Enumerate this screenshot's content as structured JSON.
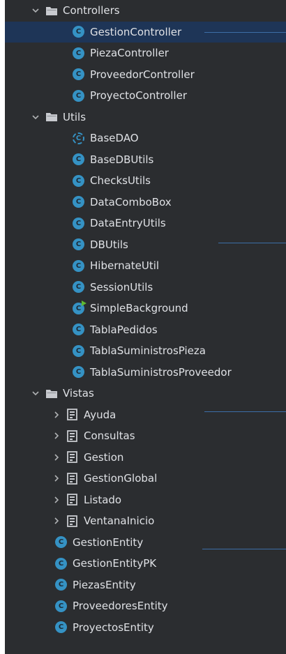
{
  "colors": {
    "background": "#2b2d30",
    "selected_row": "#1e3557",
    "class_icon": "#3592c4",
    "text": "#dfe1e5",
    "guide_line": "#3c6ea8"
  },
  "tree": {
    "controllers": {
      "label": "Controllers",
      "icon": "folder-icon",
      "expanded": true,
      "items": [
        {
          "label": "GestionController",
          "icon": "class-icon",
          "selected": true
        },
        {
          "label": "PiezaController",
          "icon": "class-icon"
        },
        {
          "label": "ProveedorController",
          "icon": "class-icon"
        },
        {
          "label": "ProyectoController",
          "icon": "class-icon"
        }
      ]
    },
    "utils": {
      "label": "Utils",
      "icon": "folder-icon",
      "expanded": true,
      "items": [
        {
          "label": "BaseDAO",
          "icon": "abstract-class-icon"
        },
        {
          "label": "BaseDBUtils",
          "icon": "class-icon"
        },
        {
          "label": "ChecksUtils",
          "icon": "class-icon"
        },
        {
          "label": "DataComboBox",
          "icon": "class-icon"
        },
        {
          "label": "DataEntryUtils",
          "icon": "class-icon"
        },
        {
          "label": "DBUtils",
          "icon": "class-icon"
        },
        {
          "label": "HibernateUtil",
          "icon": "class-icon"
        },
        {
          "label": "SessionUtils",
          "icon": "class-icon"
        },
        {
          "label": "SimpleBackground",
          "icon": "runnable-class-icon"
        },
        {
          "label": "TablaPedidos",
          "icon": "class-icon"
        },
        {
          "label": "TablaSuministrosPieza",
          "icon": "class-icon"
        },
        {
          "label": "TablaSuministrosProveedor",
          "icon": "class-icon"
        }
      ]
    },
    "vistas": {
      "label": "Vistas",
      "icon": "folder-icon",
      "expanded": true,
      "items": [
        {
          "label": "Ayuda",
          "icon": "form-icon"
        },
        {
          "label": "Consultas",
          "icon": "form-icon"
        },
        {
          "label": "Gestion",
          "icon": "form-icon"
        },
        {
          "label": "GestionGlobal",
          "icon": "form-icon"
        },
        {
          "label": "Listado",
          "icon": "form-icon"
        },
        {
          "label": "VentanaInicio",
          "icon": "form-icon"
        }
      ]
    },
    "entities": [
      {
        "label": "GestionEntity",
        "icon": "class-icon"
      },
      {
        "label": "GestionEntityPK",
        "icon": "class-icon"
      },
      {
        "label": "PiezasEntity",
        "icon": "class-icon"
      },
      {
        "label": "ProveedoresEntity",
        "icon": "class-icon"
      },
      {
        "label": "ProyectosEntity",
        "icon": "class-icon"
      }
    ]
  }
}
